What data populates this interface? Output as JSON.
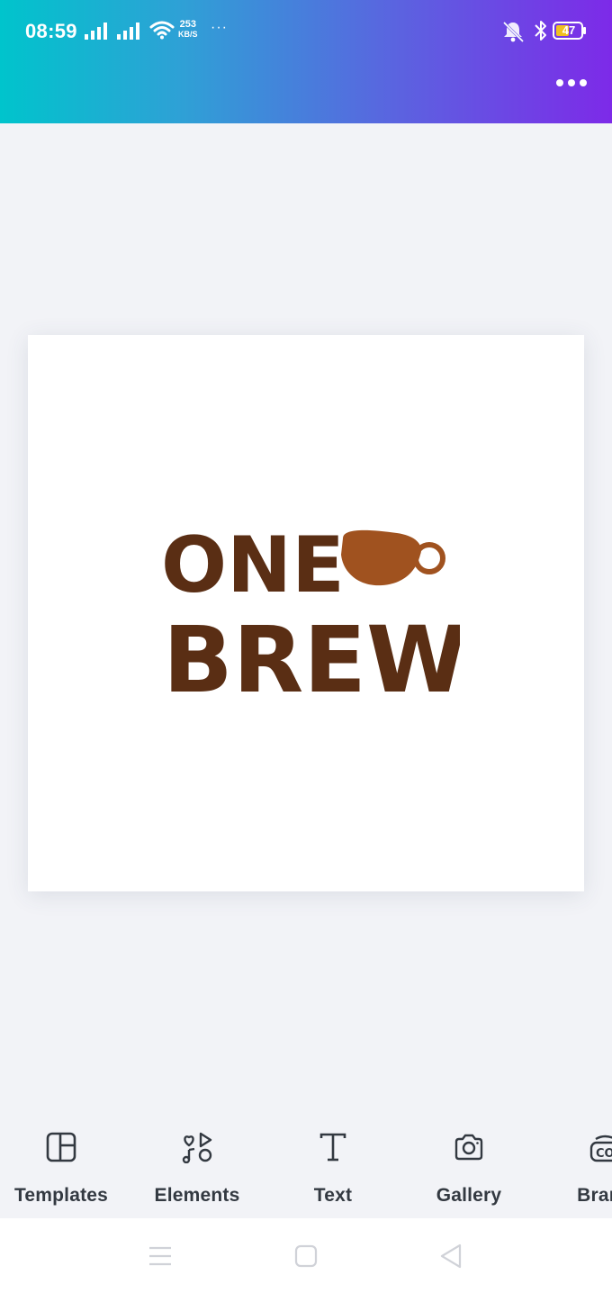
{
  "status_bar": {
    "time": "08:59",
    "speed_value": "253",
    "speed_unit": "KB/S",
    "more_dots": "···",
    "battery_level": "47"
  },
  "header": {
    "menu_icon": "more-horizontal-icon"
  },
  "design": {
    "logo_line1": "ONE",
    "logo_line2": "BREW",
    "text_color": "#5a2e14",
    "cup_color": "#a0521f"
  },
  "toolbar": {
    "items": [
      {
        "label": "Templates",
        "icon": "templates-icon"
      },
      {
        "label": "Elements",
        "icon": "elements-icon"
      },
      {
        "label": "Text",
        "icon": "text-icon"
      },
      {
        "label": "Gallery",
        "icon": "camera-icon"
      },
      {
        "label": "Brand",
        "icon": "brand-icon"
      }
    ]
  },
  "nav": {
    "items": [
      "menu-icon",
      "home-icon",
      "back-icon"
    ]
  },
  "colors": {
    "gradient_start": "#00c4cc",
    "gradient_end": "#7d2ae8",
    "background": "#f2f3f7"
  }
}
